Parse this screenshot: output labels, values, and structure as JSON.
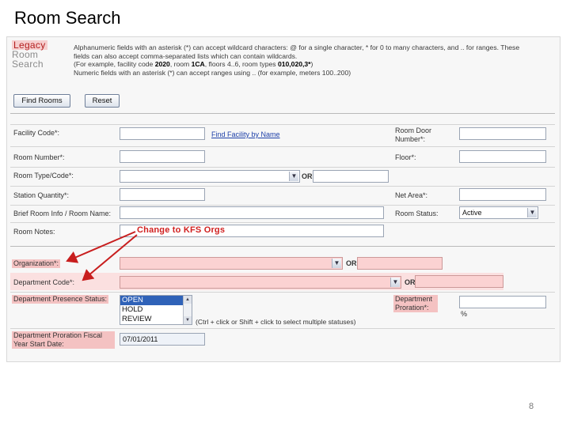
{
  "slide": {
    "title": "Room Search",
    "page_number": "8"
  },
  "logo": {
    "line1": "Legacy",
    "line2": "Room",
    "line3": "Search"
  },
  "description": {
    "line1": "Alphanumeric fields with an asterisk (*) can accept wildcard characters: @ for a single character, * for 0 to many characters, and .. for ranges. These",
    "line2": "fields can also accept comma-separated lists which can contain wildcards.",
    "line3_a": "(For example, facility code ",
    "line3_b": "2020",
    "line3_c": ", room ",
    "line3_d": "1CA",
    "line3_e": ", floors 4..6, room types ",
    "line3_f": "010,020,3*",
    "line3_g": ")",
    "line4": "Numeric fields with an asterisk (*) can accept ranges using .. (for example, meters 100..200)"
  },
  "buttons": {
    "find_rooms": "Find Rooms",
    "reset": "Reset"
  },
  "fields": {
    "facility_code": {
      "label": "Facility Code*:",
      "value": ""
    },
    "find_facility_link": "Find Facility by Name",
    "room_door_number": {
      "label": "Room Door Number*:",
      "value": ""
    },
    "room_number": {
      "label": "Room Number*:",
      "value": ""
    },
    "floor": {
      "label": "Floor*:",
      "value": ""
    },
    "room_type_code": {
      "label": "Room Type/Code*:",
      "value": ""
    },
    "station_quantity": {
      "label": "Station Quantity*:",
      "value": ""
    },
    "net_area": {
      "label": "Net Area*:",
      "value": ""
    },
    "brief_room_info": {
      "label": "Brief Room Info / Room Name:",
      "value": ""
    },
    "room_status": {
      "label": "Room Status:",
      "value": "Active"
    },
    "room_notes": {
      "label": "Room Notes:",
      "value": ""
    },
    "organization": {
      "label": "Organization*:",
      "value": ""
    },
    "department_code": {
      "label": "Department Code*:",
      "value": ""
    },
    "department_presence_status": {
      "label": "Department Presence Status:",
      "options": [
        "OPEN",
        "HOLD",
        "REVIEW"
      ],
      "hint": "(Ctrl + click or Shift + click to select multiple statuses)"
    },
    "department_proration": {
      "label": "Department Proration*:",
      "value": "",
      "unit": "%"
    },
    "department_proration_start": {
      "label": "Department Proration Fiscal Year Start Date:",
      "value": "07/01/2011"
    }
  },
  "or_label": "OR",
  "callout": {
    "text": "Change to KFS Orgs",
    "color": "#d02020"
  },
  "colors": {
    "highlight_pink": "#f4c2c2",
    "link_blue": "#1c3fa8",
    "selected_blue": "#2f62b8"
  }
}
